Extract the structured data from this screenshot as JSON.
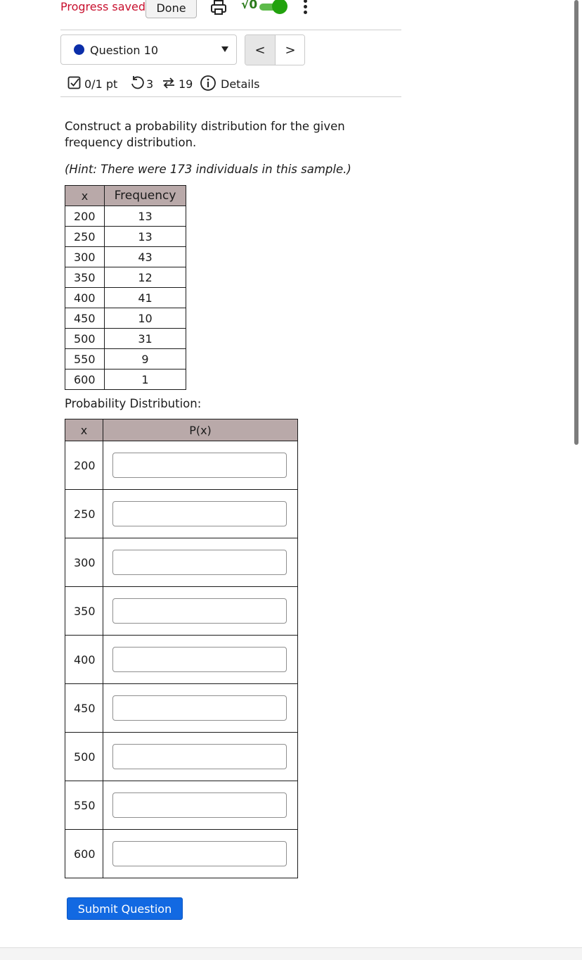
{
  "topbar": {
    "progress_text": "Progress saved",
    "done_label": "Done",
    "math_label": "√0",
    "toggle_on": true,
    "accent_color": "#22a20e"
  },
  "question_nav": {
    "selected": "Question 10",
    "prev_label": "<",
    "next_label": ">"
  },
  "meta": {
    "score": "0/1 pt",
    "retries": "3",
    "submissions": "19",
    "details_label": "Details"
  },
  "question": {
    "prompt": "Construct a probability distribution for the given frequency distribution.",
    "hint": "(Hint: There were 173 individuals in this sample.)"
  },
  "frequency_table": {
    "headers": [
      "x",
      "Frequency"
    ],
    "rows": [
      {
        "x": "200",
        "f": "13"
      },
      {
        "x": "250",
        "f": "13"
      },
      {
        "x": "300",
        "f": "43"
      },
      {
        "x": "350",
        "f": "12"
      },
      {
        "x": "400",
        "f": "41"
      },
      {
        "x": "450",
        "f": "10"
      },
      {
        "x": "500",
        "f": "31"
      },
      {
        "x": "550",
        "f": "9"
      },
      {
        "x": "600",
        "f": "1"
      }
    ]
  },
  "probability_table": {
    "label": "Probability Distribution:",
    "headers": [
      "x",
      "P(x)"
    ],
    "rows": [
      {
        "x": "200",
        "value": ""
      },
      {
        "x": "250",
        "value": ""
      },
      {
        "x": "300",
        "value": ""
      },
      {
        "x": "350",
        "value": ""
      },
      {
        "x": "400",
        "value": ""
      },
      {
        "x": "450",
        "value": ""
      },
      {
        "x": "500",
        "value": ""
      },
      {
        "x": "550",
        "value": ""
      },
      {
        "x": "600",
        "value": ""
      }
    ]
  },
  "submit_label": "Submit Question",
  "icons": [
    "print-icon",
    "more-icon",
    "checkbox-icon",
    "retry-icon",
    "submissions-icon",
    "info-icon",
    "chevron-down-icon"
  ]
}
